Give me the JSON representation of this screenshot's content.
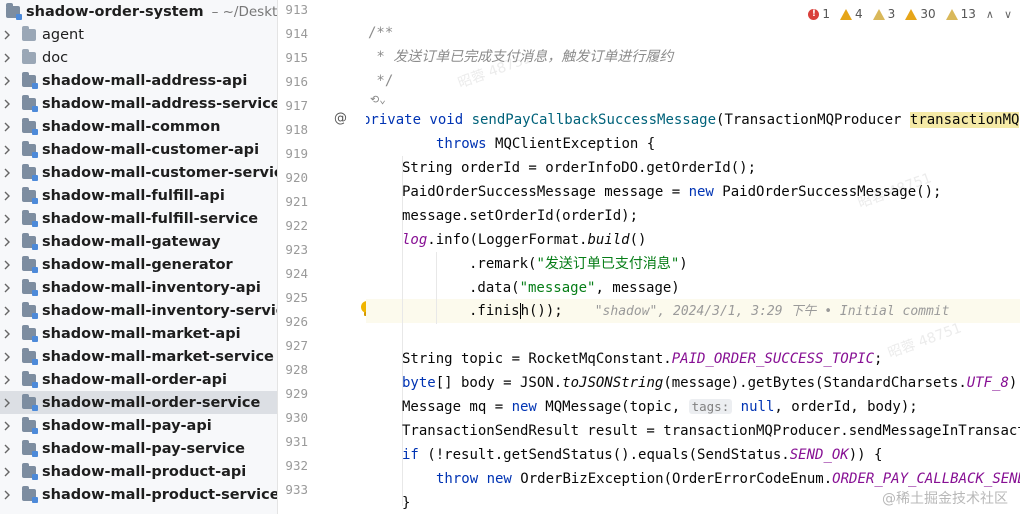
{
  "project": {
    "name": "shadow-order-system",
    "path": "~/Desktop"
  },
  "tree": [
    {
      "label": "agent",
      "bold": false
    },
    {
      "label": "doc",
      "bold": false
    },
    {
      "label": "shadow-mall-address-api",
      "bold": true
    },
    {
      "label": "shadow-mall-address-service",
      "bold": true
    },
    {
      "label": "shadow-mall-common",
      "bold": true
    },
    {
      "label": "shadow-mall-customer-api",
      "bold": true
    },
    {
      "label": "shadow-mall-customer-service",
      "bold": true
    },
    {
      "label": "shadow-mall-fulfill-api",
      "bold": true
    },
    {
      "label": "shadow-mall-fulfill-service",
      "bold": true
    },
    {
      "label": "shadow-mall-gateway",
      "bold": true
    },
    {
      "label": "shadow-mall-generator",
      "bold": true
    },
    {
      "label": "shadow-mall-inventory-api",
      "bold": true
    },
    {
      "label": "shadow-mall-inventory-service",
      "bold": true
    },
    {
      "label": "shadow-mall-market-api",
      "bold": true
    },
    {
      "label": "shadow-mall-market-service",
      "bold": true
    },
    {
      "label": "shadow-mall-order-api",
      "bold": true
    },
    {
      "label": "shadow-mall-order-service",
      "bold": true,
      "selected": true
    },
    {
      "label": "shadow-mall-pay-api",
      "bold": true
    },
    {
      "label": "shadow-mall-pay-service",
      "bold": true
    },
    {
      "label": "shadow-mall-product-api",
      "bold": true
    },
    {
      "label": "shadow-mall-product-service",
      "bold": true
    }
  ],
  "line_numbers": [
    "913",
    "914",
    "915",
    "916",
    "917",
    "918",
    "919",
    "920",
    "921",
    "922",
    "923",
    "924",
    "925",
    "926",
    "927",
    "928",
    "929",
    "930",
    "931",
    "932",
    "933"
  ],
  "override_marker": "@",
  "inspections": {
    "errors": "1",
    "warnings": "4",
    "weak_warnings": "3",
    "typos": "30",
    "other": "13"
  },
  "code": {
    "l914": "/**",
    "l915": " * 发送订单已完成支付消息，触发订单进行履约",
    "l916": " */",
    "author_hint": "⟲⌄",
    "l917_kw": "private void ",
    "l917_fn": "sendPayCallbackSuccessMessage",
    "l917_rest": "(TransactionMQProducer ",
    "l917_param": "transactionMQ",
    "l918_kw": "throws ",
    "l918_rest": "MQClientException {",
    "l919": "String orderId = orderInfoDO.getOrderId();",
    "l920_a": "PaidOrderSuccessMessage message = ",
    "l920_kw": "new ",
    "l920_b": "PaidOrderSuccessMessage();",
    "l921": "message.setOrderId(orderId);",
    "l922_fld": "log",
    "l922_a": ".info(LoggerFormat.",
    "l922_it": "build",
    "l922_b": "()",
    "l923_a": ".remark(",
    "l923_str": "\"发送订单已支付消息\"",
    "l923_b": ")",
    "l924_a": ".data(",
    "l924_str": "\"message\"",
    "l924_b": ", message)",
    "l925_a": ".finis",
    "l925_b": "h());",
    "l925_blame": "\"shadow\", 2024/3/1, 3:29 下午 • Initial commit",
    "l927_a": "String topic = RocketMqConstant.",
    "l927_const": "PAID_ORDER_SUCCESS_TOPIC",
    "l927_b": ";",
    "l928_kw": "byte",
    "l928_a": "[] body = JSON.",
    "l928_it": "toJSONString",
    "l928_b": "(message).getBytes(StandardCharsets.",
    "l928_const": "UTF_8",
    "l928_c": ");",
    "l929_a": "Message mq = ",
    "l929_kw": "new ",
    "l929_b": "MQMessage(topic, ",
    "l929_hint": "tags:",
    "l929_null": " null",
    "l929_c": ", orderId, body);",
    "l930": "TransactionSendResult result = transactionMQProducer.sendMessageInTransact",
    "l931_kw": "if ",
    "l931_a": "(!result.getSendStatus().equals(SendStatus.",
    "l931_const": "SEND_OK",
    "l931_b": ")) {",
    "l932_kw1": "throw ",
    "l932_kw2": "new ",
    "l932_a": "OrderBizException(OrderErrorCodeEnum.",
    "l932_const": "ORDER_PAY_CALLBACK_SEND",
    "l933": "}"
  },
  "watermark": "@稀土掘金技术社区",
  "bg_watermark": "昭蓉 48751",
  "colors": {
    "keyword": "#0033b3",
    "method": "#00627a",
    "string": "#067d17",
    "constant": "#871094",
    "comment": "#8c8c8c",
    "selected_row": "#dcdfe4"
  },
  "icons": [
    "folder-icon",
    "module-folder-icon",
    "chevron-right-icon",
    "error-icon",
    "warning-icon",
    "lightbulb-icon",
    "override-icon"
  ]
}
